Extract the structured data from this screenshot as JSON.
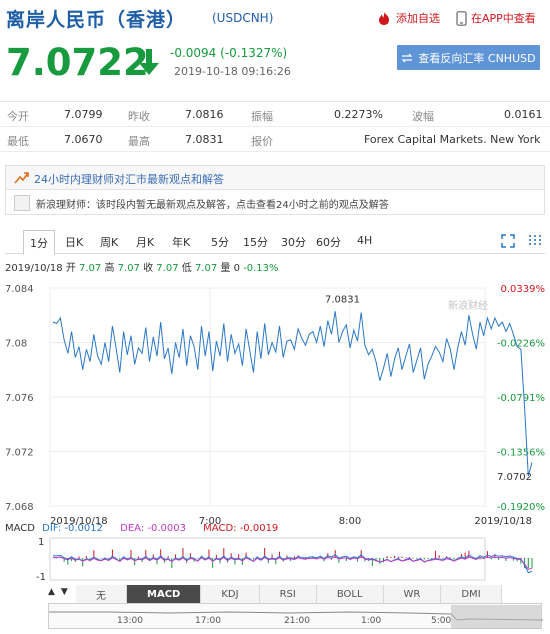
{
  "header": {
    "title": "离岸人民币（香港）",
    "code": "(USDCNH)",
    "add_watch": "添加自选",
    "view_app": "在APP中查看"
  },
  "quote": {
    "price": "7.0722",
    "change": "-0.0094",
    "change_pct": "(-0.1327%)",
    "timestamp": "2019-10-18 09:16:26",
    "reverse_btn": "查看反向汇率 CNHUSD"
  },
  "stats": {
    "row1": [
      {
        "label": "今开",
        "value": "7.0799"
      },
      {
        "label": "昨收",
        "value": "7.0816"
      },
      {
        "label": "振幅",
        "value": "0.2273%"
      },
      {
        "label": "波幅",
        "value": "0.0161"
      }
    ],
    "row2": [
      {
        "label": "最低",
        "value": "7.0670"
      },
      {
        "label": "最高",
        "value": "7.0831"
      },
      {
        "label": "报价",
        "value": "Forex Capital Markets. New York"
      }
    ]
  },
  "news": {
    "title": "24小时内理财师对汇市最新观点和解答",
    "body": "新浪理财师：该时段内暂无最新观点及解答，点击查看24小时之前的观点及解答"
  },
  "tabs": [
    "1分",
    "日K",
    "周K",
    "月K",
    "年K",
    "5分",
    "15分",
    "30分",
    "60分",
    "4H"
  ],
  "active_tab": "1分",
  "info_line": {
    "date": "2019/10/18",
    "open_label": "开",
    "open": "7.07",
    "high_label": "高",
    "high": "7.07",
    "close_label": "收",
    "close": "7.07",
    "low_label": "低",
    "low": "7.07",
    "vol_label": "量",
    "vol": "0",
    "pct": "-0.13%"
  },
  "chart_data": {
    "type": "line",
    "y_ticks": [
      "7.084",
      "7.08",
      "7.076",
      "7.072",
      "7.068"
    ],
    "y_right_ticks": [
      "0.0339%",
      "-0.0226%",
      "-0.0791%",
      "-0.1356%",
      "-0.1920%"
    ],
    "x_ticks": [
      "2019/10/18",
      "7:00",
      "8:00",
      "2019/10/18"
    ],
    "ylim": [
      7.068,
      7.084
    ],
    "high_label": "7.0831",
    "last_label": "7.0702",
    "watermark": "新浪财经",
    "series": [
      {
        "values": [
          7.0815,
          7.0814,
          7.0818,
          7.0802,
          7.0792,
          7.0808,
          7.0789,
          7.0797,
          7.078,
          7.0795,
          7.0786,
          7.0806,
          7.079,
          7.0784,
          7.08,
          7.0786,
          7.0812,
          7.0796,
          7.0778,
          7.0808,
          7.0791,
          7.0805,
          7.0784,
          7.0796,
          7.0792,
          7.0811,
          7.0786,
          7.0804,
          7.079,
          7.0815,
          7.0788,
          7.0796,
          7.0777,
          7.08,
          7.0789,
          7.081,
          7.0783,
          7.0805,
          7.0797,
          7.078,
          7.0812,
          7.079,
          7.0808,
          7.0779,
          7.0801,
          7.079,
          7.0814,
          7.0786,
          7.0806,
          7.0792,
          7.0799,
          7.0783,
          7.081,
          7.0794,
          7.0778,
          7.0808,
          7.0788,
          7.0814,
          7.0791,
          7.08,
          7.0793,
          7.0812,
          7.0789,
          7.0801,
          7.0802,
          7.0795,
          7.081,
          7.0803,
          7.0798,
          7.0806,
          7.0808,
          7.08,
          7.0812,
          7.0797,
          7.0816,
          7.0806,
          7.0823,
          7.08,
          7.0808,
          7.0813,
          7.0796,
          7.0809,
          7.0801,
          7.0822,
          7.0798,
          7.0791,
          7.0795,
          7.0786,
          7.0772,
          7.0781,
          7.0792,
          7.0775,
          7.0788,
          7.0796,
          7.078,
          7.079,
          7.0799,
          7.0778,
          7.0787,
          7.0796,
          7.0773,
          7.0784,
          7.079,
          7.0797,
          7.0793,
          7.0786,
          7.0803,
          7.0795,
          7.078,
          7.0796,
          7.0808,
          7.0798,
          7.082,
          7.0806,
          7.0795,
          7.0815,
          7.0805,
          7.0818,
          7.081,
          7.0818,
          7.0812,
          7.0815,
          7.0808,
          7.0814,
          7.0806,
          7.0797,
          7.0795,
          7.0752,
          7.0702,
          7.0712
        ],
        "color": "#2a78c6"
      }
    ],
    "macd": {
      "label": "MACD",
      "dif_label": "DIF: -0.0012",
      "dea_label": "DEA: -0.0003",
      "macd_label": "MACD: -0.0019",
      "y_ticks": [
        "1",
        "-1"
      ]
    }
  },
  "bottom_tabs": [
    "无",
    "MACD",
    "KDJ",
    "RSI",
    "BOLL",
    "WR",
    "DMI"
  ],
  "timeline_labels": [
    "13:00",
    "17:00",
    "21:00",
    "1:00",
    "5:00"
  ],
  "colors": {
    "up": "#d0171d",
    "down": "#189a3e",
    "link": "#1f5fa8",
    "line": "#2a78c6"
  }
}
